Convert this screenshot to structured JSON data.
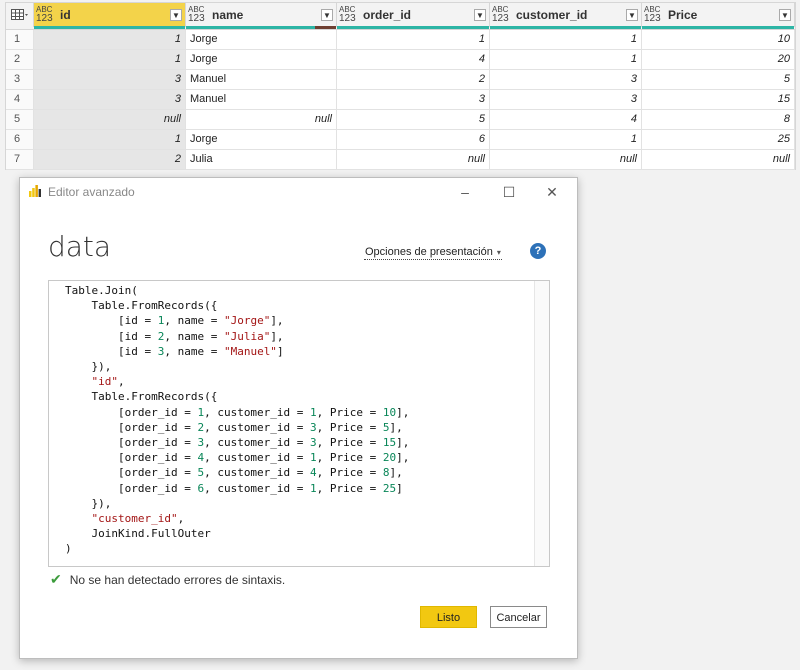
{
  "table": {
    "columns": [
      {
        "name": "id",
        "type_top": "ABC",
        "type_bottom": "123",
        "active": true,
        "error_fraction": 0.0
      },
      {
        "name": "name",
        "type_top": "ABC",
        "type_bottom": "123",
        "active": false,
        "error_fraction": 0.14
      },
      {
        "name": "order_id",
        "type_top": "ABC",
        "type_bottom": "123",
        "active": false,
        "error_fraction": 0.0
      },
      {
        "name": "customer_id",
        "type_top": "ABC",
        "type_bottom": "123",
        "active": false,
        "error_fraction": 0.0
      },
      {
        "name": "Price",
        "type_top": "ABC",
        "type_bottom": "123",
        "active": false,
        "error_fraction": 0.0
      }
    ],
    "rows": [
      {
        "num": "1",
        "cells": [
          "1",
          "Jorge",
          "1",
          "1",
          "10"
        ]
      },
      {
        "num": "2",
        "cells": [
          "1",
          "Jorge",
          "4",
          "1",
          "20"
        ]
      },
      {
        "num": "3",
        "cells": [
          "3",
          "Manuel",
          "2",
          "3",
          "5"
        ]
      },
      {
        "num": "4",
        "cells": [
          "3",
          "Manuel",
          "3",
          "3",
          "15"
        ]
      },
      {
        "num": "5",
        "cells": [
          "null",
          "null",
          "5",
          "4",
          "8"
        ]
      },
      {
        "num": "6",
        "cells": [
          "1",
          "Jorge",
          "6",
          "1",
          "25"
        ]
      },
      {
        "num": "7",
        "cells": [
          "2",
          "Julia",
          "null",
          "null",
          "null"
        ]
      }
    ],
    "colors": {
      "quality_ok": "#2db5a5",
      "quality_error": "#6e3f31",
      "active_header": "#f3d34a"
    }
  },
  "dialog": {
    "title": "Editor avanzado",
    "query_name": "data",
    "display_options_label": "Opciones de presentación",
    "help_label": "?",
    "code_lines": [
      [
        {
          "t": "Table.Join("
        }
      ],
      [
        {
          "t": "    Table.FromRecords({"
        }
      ],
      [
        {
          "t": "        [id = "
        },
        {
          "t": "1",
          "c": "n"
        },
        {
          "t": ", name = "
        },
        {
          "t": "\"Jorge\"",
          "c": "s"
        },
        {
          "t": "],"
        }
      ],
      [
        {
          "t": "        [id = "
        },
        {
          "t": "2",
          "c": "n"
        },
        {
          "t": ", name = "
        },
        {
          "t": "\"Julia\"",
          "c": "s"
        },
        {
          "t": "],"
        }
      ],
      [
        {
          "t": "        [id = "
        },
        {
          "t": "3",
          "c": "n"
        },
        {
          "t": ", name = "
        },
        {
          "t": "\"Manuel\"",
          "c": "s"
        },
        {
          "t": "]"
        }
      ],
      [
        {
          "t": "    }),"
        }
      ],
      [
        {
          "t": "    "
        },
        {
          "t": "\"id\"",
          "c": "s"
        },
        {
          "t": ","
        }
      ],
      [
        {
          "t": "    Table.FromRecords({"
        }
      ],
      [
        {
          "t": "        [order_id = "
        },
        {
          "t": "1",
          "c": "n"
        },
        {
          "t": ", customer_id = "
        },
        {
          "t": "1",
          "c": "n"
        },
        {
          "t": ", Price = "
        },
        {
          "t": "10",
          "c": "n"
        },
        {
          "t": "],"
        }
      ],
      [
        {
          "t": "        [order_id = "
        },
        {
          "t": "2",
          "c": "n"
        },
        {
          "t": ", customer_id = "
        },
        {
          "t": "3",
          "c": "n"
        },
        {
          "t": ", Price = "
        },
        {
          "t": "5",
          "c": "n"
        },
        {
          "t": "],"
        }
      ],
      [
        {
          "t": "        [order_id = "
        },
        {
          "t": "3",
          "c": "n"
        },
        {
          "t": ", customer_id = "
        },
        {
          "t": "3",
          "c": "n"
        },
        {
          "t": ", Price = "
        },
        {
          "t": "15",
          "c": "n"
        },
        {
          "t": "],"
        }
      ],
      [
        {
          "t": "        [order_id = "
        },
        {
          "t": "4",
          "c": "n"
        },
        {
          "t": ", customer_id = "
        },
        {
          "t": "1",
          "c": "n"
        },
        {
          "t": ", Price = "
        },
        {
          "t": "20",
          "c": "n"
        },
        {
          "t": "],"
        }
      ],
      [
        {
          "t": "        [order_id = "
        },
        {
          "t": "5",
          "c": "n"
        },
        {
          "t": ", customer_id = "
        },
        {
          "t": "4",
          "c": "n"
        },
        {
          "t": ", Price = "
        },
        {
          "t": "8",
          "c": "n"
        },
        {
          "t": "],"
        }
      ],
      [
        {
          "t": "        [order_id = "
        },
        {
          "t": "6",
          "c": "n"
        },
        {
          "t": ", customer_id = "
        },
        {
          "t": "1",
          "c": "n"
        },
        {
          "t": ", Price = "
        },
        {
          "t": "25",
          "c": "n"
        },
        {
          "t": "]"
        }
      ],
      [
        {
          "t": "    }),"
        }
      ],
      [
        {
          "t": "    "
        },
        {
          "t": "\"customer_id\"",
          "c": "s"
        },
        {
          "t": ","
        }
      ],
      [
        {
          "t": "    JoinKind.FullOuter"
        }
      ],
      [
        {
          "t": ")"
        }
      ]
    ],
    "status_text": "No se han detectado errores de sintaxis.",
    "ok_label": "Listo",
    "cancel_label": "Cancelar",
    "colors": {
      "ok_button": "#f2c811",
      "help_icon": "#2d71b8",
      "check": "#3c9c3c",
      "string": "#a31515",
      "number": "#098658"
    }
  }
}
